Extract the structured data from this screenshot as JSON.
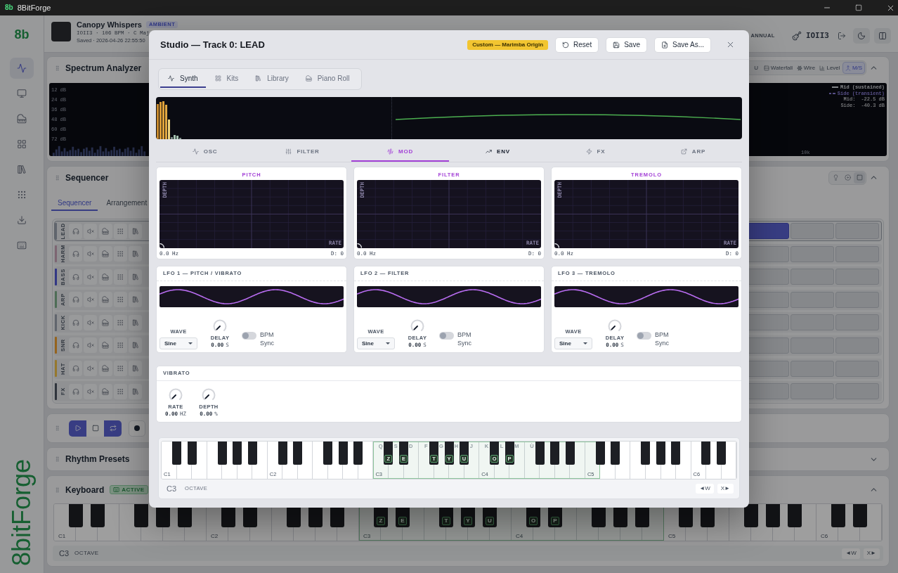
{
  "window": {
    "logo": "8b",
    "title": "8BitForge"
  },
  "sidebar": {
    "logo": "8b",
    "items": [
      {
        "kind": "pulse",
        "selected": true
      },
      {
        "kind": "monitor",
        "selected": false
      },
      {
        "kind": "piano",
        "selected": false
      },
      {
        "kind": "grid",
        "selected": false
      },
      {
        "kind": "library",
        "selected": false
      },
      {
        "kind": "dots",
        "selected": false
      },
      {
        "kind": "download",
        "selected": false
      },
      {
        "kind": "keyboard",
        "selected": false
      }
    ],
    "wordmark": "8bitForge"
  },
  "header": {
    "song_title": "Canopy Whispers",
    "genre": "AMBIENT",
    "meta": "IOII3 · 106 BPM · C Maj",
    "saved": "Saved · 2026-04-26 22:55:50",
    "plan": "ANNUAL",
    "user": "IOII3"
  },
  "spectrum": {
    "title": "Spectrum Analyzer",
    "expanded": true,
    "views": [
      {
        "kind": "vu",
        "label": "U",
        "selected": false
      },
      {
        "kind": "waterfall",
        "label": "Waterfall",
        "selected": false
      },
      {
        "kind": "wire",
        "label": "Wire",
        "selected": false
      },
      {
        "kind": "level",
        "label": "Level",
        "selected": false
      },
      {
        "kind": "ms",
        "label": "M/S",
        "selected": true
      }
    ],
    "db_labels": [
      "12 dB",
      "24 dB",
      "36 dB",
      "48 dB",
      "60 dB",
      "72 dB"
    ],
    "legend": [
      {
        "kind": "solid",
        "label": "Mid (sustained)",
        "color": "#828488"
      },
      {
        "kind": "dashed",
        "label": "Side (transient)",
        "color": "#564f86"
      }
    ],
    "readouts": [
      {
        "label": "Mid:",
        "value": "-22.5 dB"
      },
      {
        "label": "Side:",
        "value": "-40.3 dB"
      }
    ],
    "freq_label": "10k"
  },
  "sequencer": {
    "title": "Sequencer",
    "expanded": true,
    "modes": [
      {
        "kind": "bulb",
        "selected": false
      },
      {
        "kind": "disc",
        "selected": false
      },
      {
        "kind": "square",
        "selected": true
      }
    ],
    "tabs": [
      {
        "label": "Sequencer",
        "selected": true
      },
      {
        "label": "Arrangement",
        "selected": false
      }
    ],
    "tracks": [
      {
        "name": "LEAD",
        "color": "#61656d",
        "selected": true,
        "steps": [
          {
            "active": true
          },
          {
            "active": false
          },
          {
            "active": false
          }
        ]
      },
      {
        "name": "HARM",
        "color": "#7d6572",
        "selected": false,
        "steps": [
          {
            "active": false
          },
          {
            "active": false
          },
          {
            "active": false
          }
        ]
      },
      {
        "name": "BASS",
        "color": "#323785",
        "selected": false,
        "steps": [
          {
            "active": false
          },
          {
            "active": false
          },
          {
            "active": false
          }
        ]
      },
      {
        "name": "ARP",
        "color": "#4f6e56",
        "selected": false,
        "steps": [
          {
            "active": false
          },
          {
            "active": false
          },
          {
            "active": false
          }
        ]
      },
      {
        "name": "KICK",
        "color": "#61656d",
        "selected": false,
        "steps": [
          {
            "active": false
          },
          {
            "active": false
          },
          {
            "active": false
          }
        ]
      },
      {
        "name": "SNR",
        "color": "#95631e",
        "selected": false,
        "steps": [
          {
            "active": false
          },
          {
            "active": false
          },
          {
            "active": false
          }
        ]
      },
      {
        "name": "HAT",
        "color": "#96782e",
        "selected": false,
        "steps": [
          {
            "active": false
          },
          {
            "active": false
          },
          {
            "active": false
          }
        ]
      },
      {
        "name": "FX",
        "color": "#2f353d",
        "selected": false,
        "steps": [
          {
            "active": false
          },
          {
            "active": false
          },
          {
            "active": false
          }
        ]
      }
    ]
  },
  "transport": {
    "buttons": [
      {
        "kind": "play",
        "on": true
      },
      {
        "kind": "stop",
        "on": false
      },
      {
        "kind": "loop",
        "on": true
      },
      {
        "kind": "record",
        "on": false
      }
    ]
  },
  "rhythm_presets": {
    "title": "Rhythm Presets",
    "expanded": false
  },
  "keyboard": {
    "title": "Keyboard",
    "status": "ACTIVE",
    "expanded": true,
    "octaves": [
      {
        "label": "C1",
        "partial": false,
        "mapped": false
      },
      {
        "label": "C2",
        "partial": false,
        "mapped": false
      },
      {
        "label": "C3",
        "partial": false,
        "mapped": true,
        "black_hints": [
          "Z",
          "E",
          "T",
          "Y",
          "U"
        ]
      },
      {
        "label": "C4",
        "partial": false,
        "mapped": true,
        "black_hints": [
          "O",
          "P"
        ]
      },
      {
        "label": "C5",
        "partial": false,
        "mapped": false
      },
      {
        "label": "C6",
        "partial": true,
        "mapped": false
      }
    ],
    "octave": "C3",
    "octave_label": "OCTAVE",
    "down": "◄W",
    "up": "X►"
  },
  "studio": {
    "title": "Studio — Track 0: LEAD",
    "preset_badge": "Custom — Marimba Origin",
    "actions": [
      {
        "kind": "reset",
        "label": "Reset"
      },
      {
        "kind": "save",
        "label": "Save"
      },
      {
        "kind": "save_as",
        "label": "Save As..."
      }
    ],
    "tabs": [
      {
        "kind": "synth",
        "label": "Synth",
        "selected": true
      },
      {
        "kind": "kits",
        "label": "Kits",
        "selected": false
      },
      {
        "kind": "library",
        "label": "Library",
        "selected": false
      },
      {
        "kind": "piano_roll",
        "label": "Piano Roll",
        "selected": false
      }
    ],
    "sections": [
      {
        "kind": "osc",
        "label": "OSC",
        "selected": false,
        "hovered": false
      },
      {
        "kind": "filter",
        "label": "FILTER",
        "selected": false,
        "hovered": false
      },
      {
        "kind": "mod",
        "label": "MOD",
        "selected": true,
        "hovered": false
      },
      {
        "kind": "env",
        "label": "ENV",
        "selected": false,
        "hovered": true
      },
      {
        "kind": "fx",
        "label": "FX",
        "selected": false,
        "hovered": false
      },
      {
        "kind": "arp",
        "label": "ARP",
        "selected": false,
        "hovered": false
      }
    ],
    "mod_targets": [
      {
        "title": "PITCH",
        "y_axis": "DEPTH",
        "x_axis": "RATE",
        "rate": "0.0 Hz",
        "depth": "D: 0"
      },
      {
        "title": "FILTER",
        "y_axis": "DEPTH",
        "x_axis": "RATE",
        "rate": "0.0 Hz",
        "depth": "D: 0"
      },
      {
        "title": "TREMOLO",
        "y_axis": "DEPTH",
        "x_axis": "RATE",
        "rate": "0.0 Hz",
        "depth": "D: 0"
      }
    ],
    "lfos": [
      {
        "title": "LFO 1 — PITCH / VIBRATO",
        "wave_label": "WAVE",
        "wave": "Sine",
        "delay": {
          "label": "DELAY",
          "value": "0.00",
          "unit": "S"
        },
        "bpm_sync": false,
        "sync_label": "BPM Sync"
      },
      {
        "title": "LFO 2 — FILTER",
        "wave_label": "WAVE",
        "wave": "Sine",
        "delay": {
          "label": "DELAY",
          "value": "0.00",
          "unit": "S"
        },
        "bpm_sync": false,
        "sync_label": "BPM Sync"
      },
      {
        "title": "LFO 3 — TREMOLO",
        "wave_label": "WAVE",
        "wave": "Sine",
        "delay": {
          "label": "DELAY",
          "value": "0.00",
          "unit": "S"
        },
        "bpm_sync": false,
        "sync_label": "BPM Sync"
      }
    ],
    "vibrato": {
      "title": "VIBRATO",
      "knobs": [
        {
          "label": "RATE",
          "value": "0.00",
          "unit": "HZ"
        },
        {
          "label": "DEPTH",
          "value": "0.00",
          "unit": "%"
        }
      ]
    },
    "keyboard": {
      "octaves": [
        {
          "label": "C1",
          "partial": false,
          "mapped": false
        },
        {
          "label": "C2",
          "partial": false,
          "mapped": false
        },
        {
          "label": "C3",
          "partial": false,
          "mapped": true,
          "white_hints": [
            "Q",
            "S",
            "D",
            "F",
            "G",
            "H",
            "J"
          ],
          "black_hints": [
            "Z",
            "E",
            "T",
            "Y",
            "U"
          ]
        },
        {
          "label": "C4",
          "partial": false,
          "mapped": true,
          "white_hints": [
            "K",
            "L",
            "M",
            "Ù"
          ],
          "black_hints": [
            "O",
            "P"
          ]
        },
        {
          "label": "C5",
          "partial": false,
          "mapped": false
        },
        {
          "label": "C6",
          "partial": true,
          "mapped": false
        }
      ],
      "octave": "C3",
      "octave_label": "OCTAVE",
      "down": "◄W",
      "up": "X►"
    }
  }
}
